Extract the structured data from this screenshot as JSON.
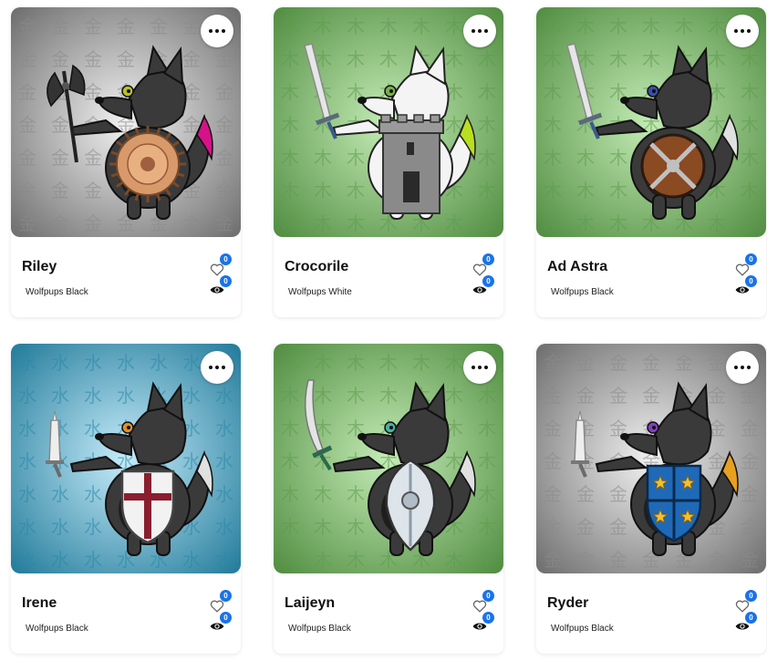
{
  "cards": [
    {
      "name": "Riley",
      "collection": "Wolfpups Black",
      "likes": "0",
      "views": "0",
      "theme": "gray",
      "kanji": "金",
      "wolf": "#3a3a3a",
      "eye": "#b8c02a",
      "tail": "#d6128a",
      "weapon": "axe",
      "shield": "spiked"
    },
    {
      "name": "Crocorile",
      "collection": "Wolfpups White",
      "likes": "0",
      "views": "0",
      "theme": "green",
      "kanji": "木",
      "wolf": "#f4f4f4",
      "eye": "#7ab04a",
      "tail": "#b8e020",
      "weapon": "sword",
      "shield": "tower"
    },
    {
      "name": "Ad Astra",
      "collection": "Wolfpups Black",
      "likes": "0",
      "views": "0",
      "theme": "green",
      "kanji": "木",
      "wolf": "#3a3a3a",
      "eye": "#3a4ea8",
      "tail": "#e0e0e0",
      "weapon": "sword",
      "shield": "round"
    },
    {
      "name": "Irene",
      "collection": "Wolfpups Black",
      "likes": "0",
      "views": "0",
      "theme": "blue",
      "kanji": "水",
      "wolf": "#3a3a3a",
      "eye": "#e0902a",
      "tail": "#e0e0e0",
      "weapon": "dagger",
      "shield": "cross"
    },
    {
      "name": "Laijeyn",
      "collection": "Wolfpups Black",
      "likes": "0",
      "views": "0",
      "theme": "green",
      "kanji": "木",
      "wolf": "#3a3a3a",
      "eye": "#4ab0a0",
      "tail": "#e0e0e0",
      "weapon": "scimitar",
      "shield": "kite"
    },
    {
      "name": "Ryder",
      "collection": "Wolfpups Black",
      "likes": "0",
      "views": "0",
      "theme": "gray",
      "kanji": "金",
      "wolf": "#3a3a3a",
      "eye": "#8040c0",
      "tail": "#e8a020",
      "weapon": "dagger",
      "shield": "stars"
    }
  ],
  "themes": {
    "gray": {
      "center": "#f2f2f2",
      "edge": "#6a6a6a",
      "glyph": "#8a8a8a"
    },
    "green": {
      "center": "#c4ecb6",
      "edge": "#4e8a3e",
      "glyph": "#5e9a4e"
    },
    "blue": {
      "center": "#c6ecfa",
      "edge": "#1e7898",
      "glyph": "#2a88a8"
    }
  },
  "icons": {
    "menu": "more-horizontal-icon",
    "like": "heart-icon",
    "view": "eye-icon"
  }
}
